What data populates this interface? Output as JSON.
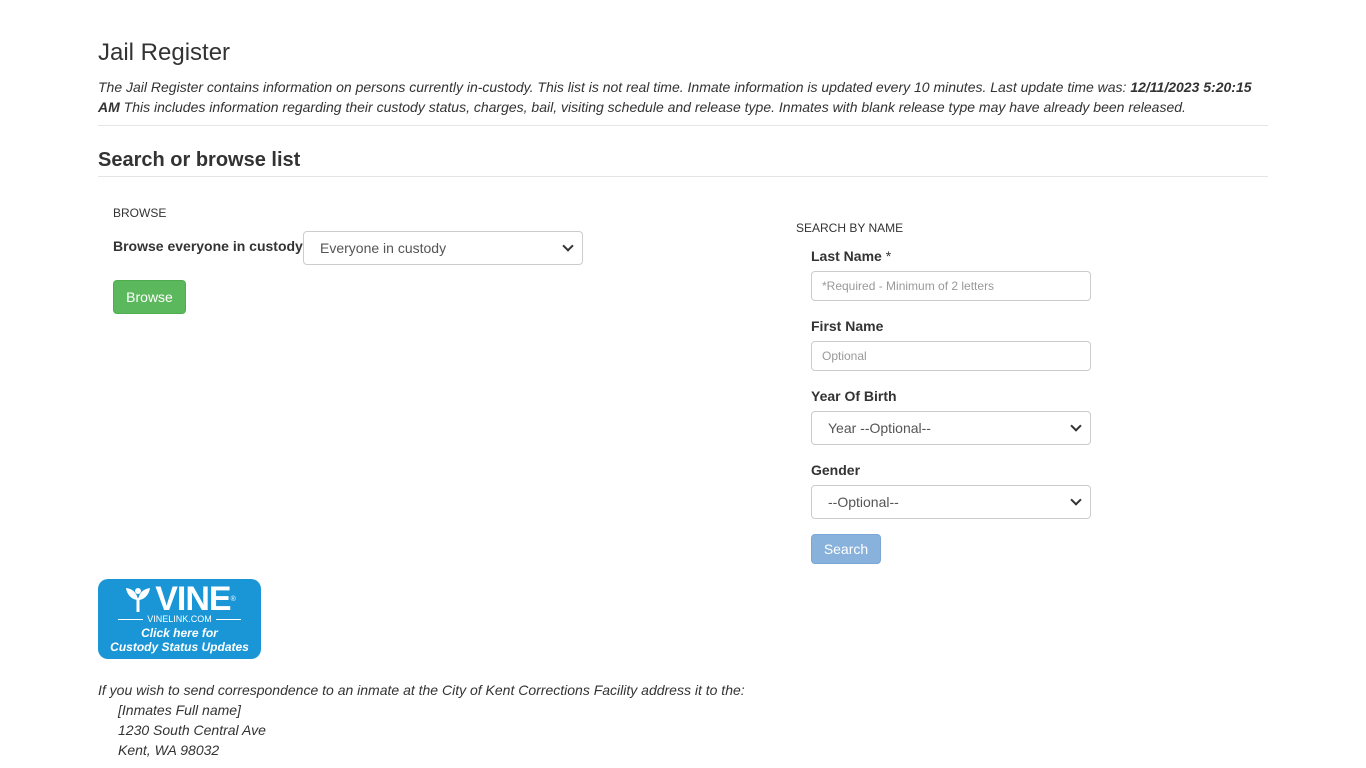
{
  "page": {
    "title": "Jail Register",
    "intro_text": "The Jail Register contains information on persons currently in-custody. This list is not real time. Inmate information is updated every 10 minutes. Last update time was: ",
    "last_update": "12/11/2023 5:20:15 AM",
    "intro_text_2": " This includes information regarding their custody status, charges, bail, visiting schedule and release type. Inmates with blank release type may have already been released."
  },
  "section": {
    "title": "Search or browse list"
  },
  "browse": {
    "heading": "BROWSE",
    "label": "Browse everyone in custody",
    "selected": "Everyone in custody",
    "button": "Browse"
  },
  "search": {
    "heading": "SEARCH BY NAME",
    "last_name_label": "Last Name",
    "required_mark": "*",
    "last_name_placeholder": "*Required - Minimum of 2 letters",
    "first_name_label": "First Name",
    "first_name_placeholder": "Optional",
    "year_label": "Year Of Birth",
    "year_selected": "Year --Optional--",
    "gender_label": "Gender",
    "gender_selected": "--Optional--",
    "button": "Search"
  },
  "vine": {
    "word": "VINE",
    "reg": "®",
    "url": "VINELINK.COM",
    "cta_line1": "Click here for",
    "cta_line2": "Custody Status Updates"
  },
  "correspondence": {
    "intro": "If you wish to send correspondence to an inmate at the City of Kent Corrections Facility address it to the:",
    "line1": "[Inmates Full name]",
    "line2": "1230 South Central Ave",
    "line3": "Kent, WA 98032"
  },
  "colors": {
    "success": "#5cb85c",
    "primary_disabled": "#88b1dc",
    "vine_blue": "#1a96d6"
  }
}
